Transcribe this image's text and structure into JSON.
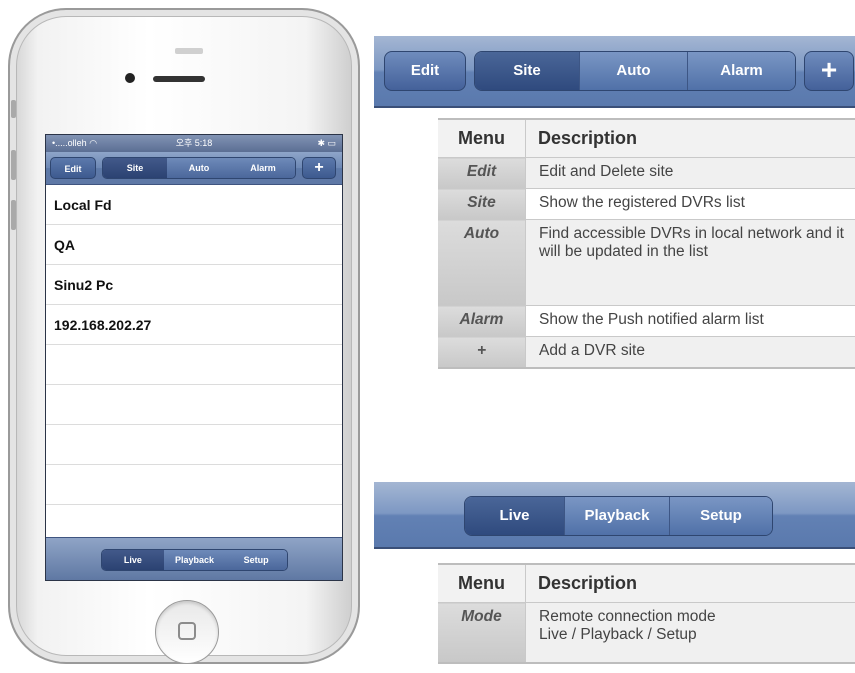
{
  "phone": {
    "statusbar": {
      "carrier": "•.....olleh",
      "wifi_icon": "wifi-icon",
      "time": "오후 5:18",
      "battery": "✱ ▭"
    },
    "toolbar": {
      "edit": "Edit",
      "site": "Site",
      "auto": "Auto",
      "alarm": "Alarm",
      "add": "+"
    },
    "sites": [
      "Local Fd",
      "QA",
      "Sinu2 Pc",
      "192.168.202.27"
    ],
    "tabs": {
      "live": "Live",
      "playback": "Playback",
      "setup": "Setup"
    }
  },
  "top_toolbar": {
    "edit": "Edit",
    "site": "Site",
    "auto": "Auto",
    "alarm": "Alarm",
    "add": "+"
  },
  "table1": {
    "header_menu": "Menu",
    "header_desc": "Description",
    "rows": [
      {
        "menu": "Edit",
        "desc": "Edit and Delete site"
      },
      {
        "menu": "Site",
        "desc": "Show the registered DVRs list"
      },
      {
        "menu": "Auto",
        "desc": "Find accessible DVRs in local network and it will be updated in the list"
      },
      {
        "menu": "Alarm",
        "desc": "Show the Push notified alarm list"
      },
      {
        "menu": "+",
        "desc": "Add a DVR site"
      }
    ]
  },
  "bottom_toolbar": {
    "live": "Live",
    "playback": "Playback",
    "setup": "Setup"
  },
  "table2": {
    "header_menu": "Menu",
    "header_desc": "Description",
    "rows": [
      {
        "menu": "Mode",
        "desc_line1": "Remote connection mode",
        "desc_line2": "Live / Playback / Setup"
      }
    ]
  }
}
